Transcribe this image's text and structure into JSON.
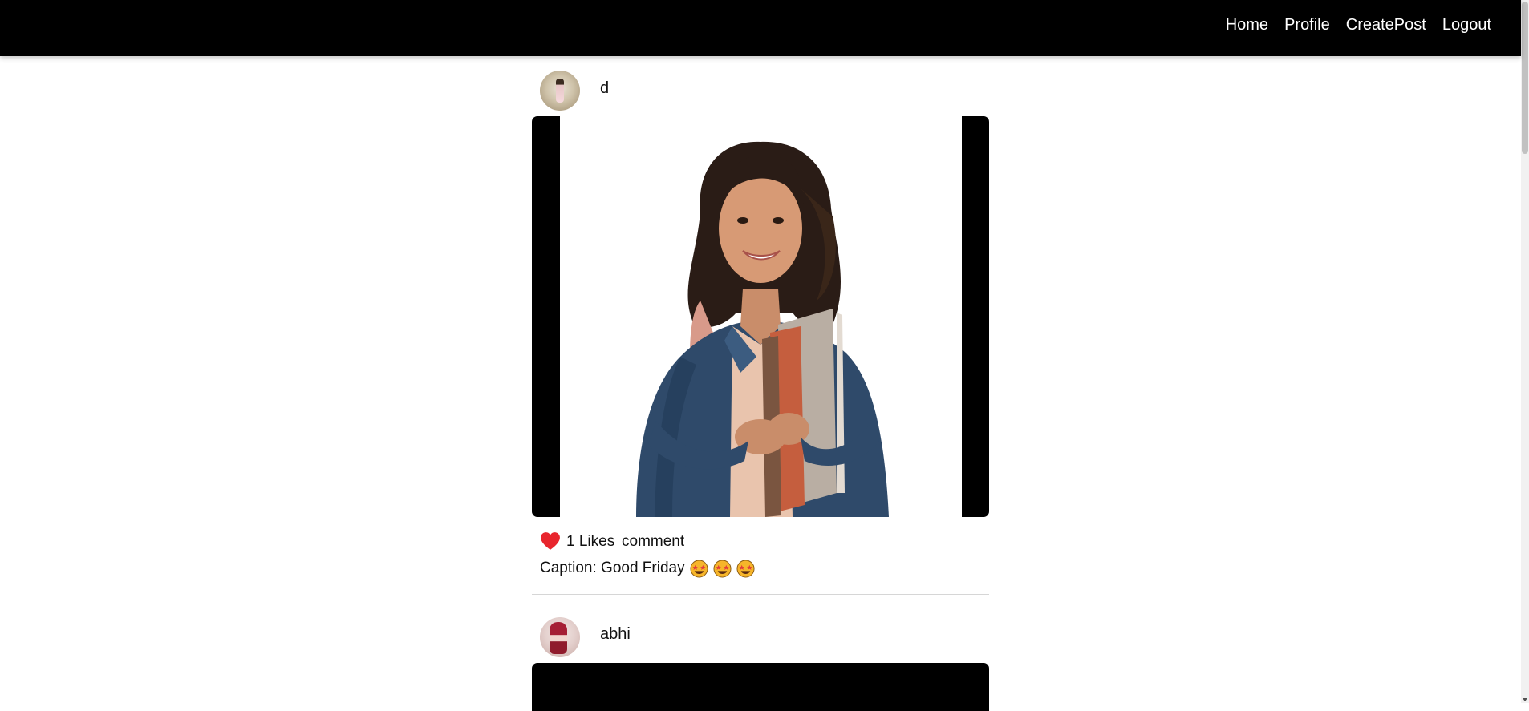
{
  "nav": {
    "links": [
      "Home",
      "Profile",
      "CreatePost",
      "Logout"
    ]
  },
  "posts": [
    {
      "username": "d",
      "likes": "1 Likes",
      "comment": "comment",
      "caption": "Caption: Good Friday"
    },
    {
      "username": "abhi"
    }
  ],
  "colors": {
    "navbar": "#000000",
    "heart": "#e8252d"
  },
  "icons": {
    "like": "heart-icon",
    "emoji": "star-struck-emoji"
  }
}
